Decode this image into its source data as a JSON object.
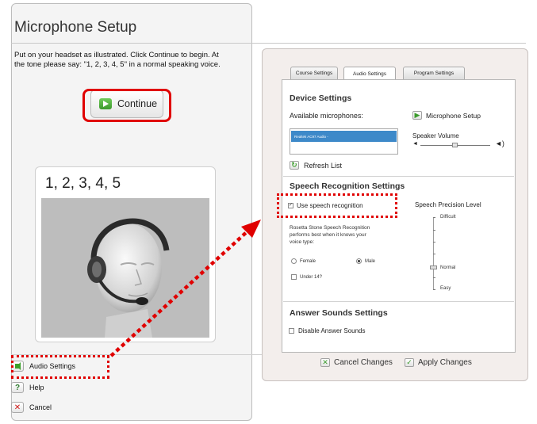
{
  "left": {
    "title": "Microphone Setup",
    "instructions": "Put on your headset as illustrated. Click Continue to begin. At the tone please say: \"1, 2, 3, 4, 5\" in a normal speaking voice.",
    "continue_label": "Continue",
    "card_text": "1, 2, 3, 4, 5",
    "links": [
      {
        "label": "Audio Settings",
        "icon": "speaker-icon"
      },
      {
        "label": "Help",
        "icon": "question-icon"
      },
      {
        "label": "Cancel",
        "icon": "x-icon"
      }
    ]
  },
  "right": {
    "tabs": [
      "Course Settings",
      "Audio Settings",
      "Program Settings"
    ],
    "active_tab": "Audio Settings",
    "device": {
      "heading": "Device Settings",
      "available_label": "Available microphones:",
      "selected_mic": "Realtek AC97 Audio -",
      "mic_setup_label": "Microphone Setup",
      "speaker_volume_label": "Speaker Volume",
      "refresh_label": "Refresh List"
    },
    "speech": {
      "heading": "Speech Recognition Settings",
      "use_label": "Use speech recognition",
      "description": "Rosetta Stone Speech Recognition performs best when it knows your voice type:",
      "female_label": "Female",
      "male_label": "Male",
      "under14_label": "Under 14?",
      "precision_label": "Speech Precision Level",
      "difficult_label": "Difficult",
      "normal_label": "Normal",
      "easy_label": "Easy"
    },
    "answer": {
      "heading": "Answer Sounds Settings",
      "disable_label": "Disable Answer Sounds"
    },
    "footer": {
      "cancel_label": "Cancel Changes",
      "apply_label": "Apply Changes"
    }
  },
  "colors": {
    "highlight": "#e00000",
    "accent_green": "#3d9a2d",
    "selection_blue": "#3d89c9"
  }
}
